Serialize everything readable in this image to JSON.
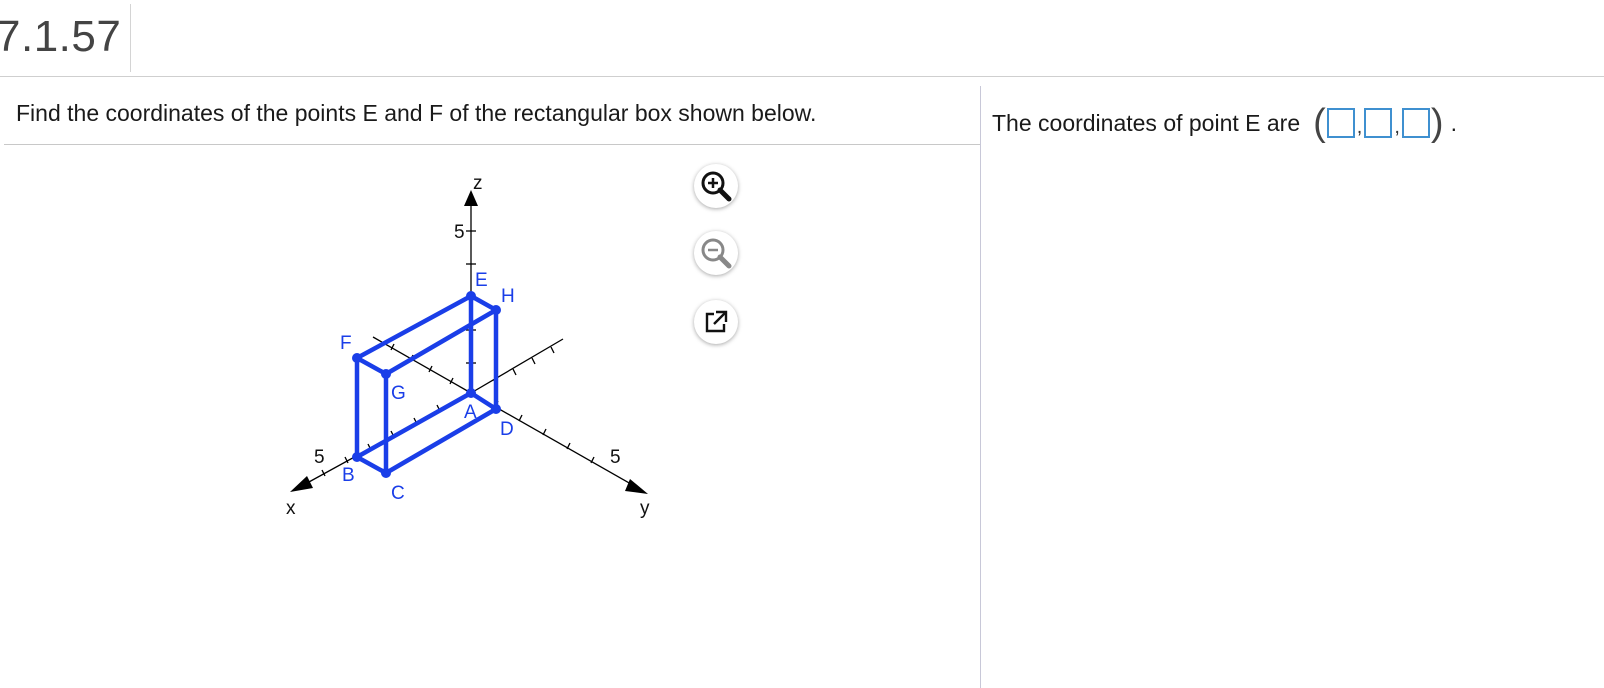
{
  "header": {
    "problem_number": "7.1.57"
  },
  "question": {
    "text": "Find the coordinates of the points E and F of the rectangular box shown below."
  },
  "figure": {
    "axis_labels": {
      "x": "x",
      "y": "y",
      "z": "z"
    },
    "tick_labels": {
      "x": "5",
      "y": "5",
      "z": "5"
    },
    "points": {
      "A": "A",
      "B": "B",
      "C": "C",
      "D": "D",
      "E": "E",
      "F": "F",
      "G": "G",
      "H": "H"
    },
    "box_color": "#1a3ee8",
    "axis_color": "#000000"
  },
  "tools": {
    "zoom_in_icon": "zoom-in-icon",
    "zoom_out_icon": "zoom-out-icon",
    "popout_icon": "external-window-icon"
  },
  "answer": {
    "prompt": "The coordinates of point E are",
    "open_paren": "(",
    "close_paren": ")",
    "comma": ",",
    "period": ".",
    "values": [
      "",
      "",
      ""
    ]
  }
}
